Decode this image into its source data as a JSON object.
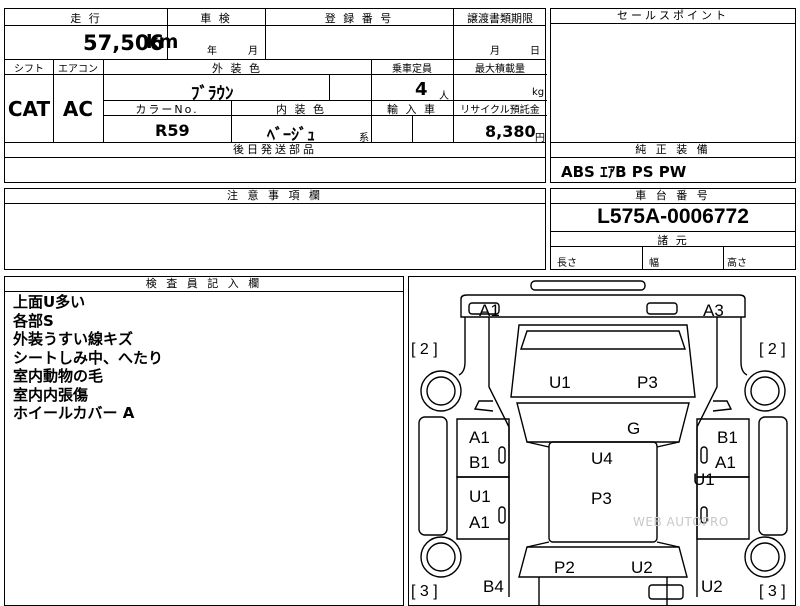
{
  "header": {
    "mileage_label": "走 行",
    "shaken_label": "車 検",
    "registration_label": "登 録 番 号",
    "transfer_label": "譲渡書類期限",
    "sales_point_label": "セールスポイント"
  },
  "row1": {
    "mileage": "57,506",
    "mileage_unit": "km",
    "shaken_year": "年",
    "shaken_month": "月",
    "transfer_month": "月",
    "transfer_day": "日"
  },
  "row2": {
    "shift_label": "シフト",
    "ac_label": "エアコン",
    "exterior_label": "外 装 色",
    "capacity_label": "乗車定員",
    "max_load_label": "最大積載量",
    "exterior_color": "ﾌﾞﾗｳﾝ",
    "capacity": "4",
    "capacity_unit": "人",
    "load_unit": "kg",
    "shift": "CAT",
    "ac": "AC",
    "color_no_label": "カラーNo.",
    "interior_label": "内 装 色",
    "import_label": "輸 入 車",
    "recycle_label": "リサイクル預託金",
    "color_no": "R59",
    "interior_color": "ﾍﾞｰｼﾞｭ",
    "interior_suffix": "系",
    "recycle": "8,380",
    "recycle_unit": "円"
  },
  "equipment": {
    "genuine_label": "純 正 装 備",
    "genuine_items": "ABS ｴｱB PS PW",
    "later_parts_label": "後日発送部品"
  },
  "notes": {
    "caution_label": "注 意 事 項 欄",
    "chassis_label": "車 台 番 号",
    "chassis_no": "L575A-0006772",
    "dimensions_label": "諸 元",
    "length_label": "長さ",
    "width_label": "幅",
    "height_label": "高さ"
  },
  "inspector": {
    "title": "検 査 員 記 入 欄",
    "remarks": [
      "上面U多い",
      "各部S",
      "外装うすい線キズ",
      "シートしみ中、へたり",
      "室内動物の毛",
      "室内内張傷",
      "ホイールカバー A"
    ]
  },
  "diagram": {
    "marks": {
      "a1_front_left": "A1",
      "a3_front_right": "A3",
      "bracket_left_top": "[ 2 ]",
      "bracket_right_top": "[ 2 ]",
      "u1_hood": "U1",
      "p3_hood": "P3",
      "g_windshield": "G",
      "a1_left_door": "A1",
      "b1_left_door": "B1",
      "u1_left_rear": "U1",
      "a1_left_rear": "A1",
      "u4_roof": "U4",
      "p3_roof": "P3",
      "b1_right_door": "B1",
      "a1_right_door": "A1",
      "u1_right_rear": "U1",
      "p2_rear": "P2",
      "u2_rear": "U2",
      "b4_rear_left": "B4",
      "u2_rear_right": "U2",
      "bracket_left_bottom": "[ 3 ]",
      "bracket_right_bottom": "[ 3 ]",
      "watermark": "WEB AUTOPRO"
    }
  }
}
